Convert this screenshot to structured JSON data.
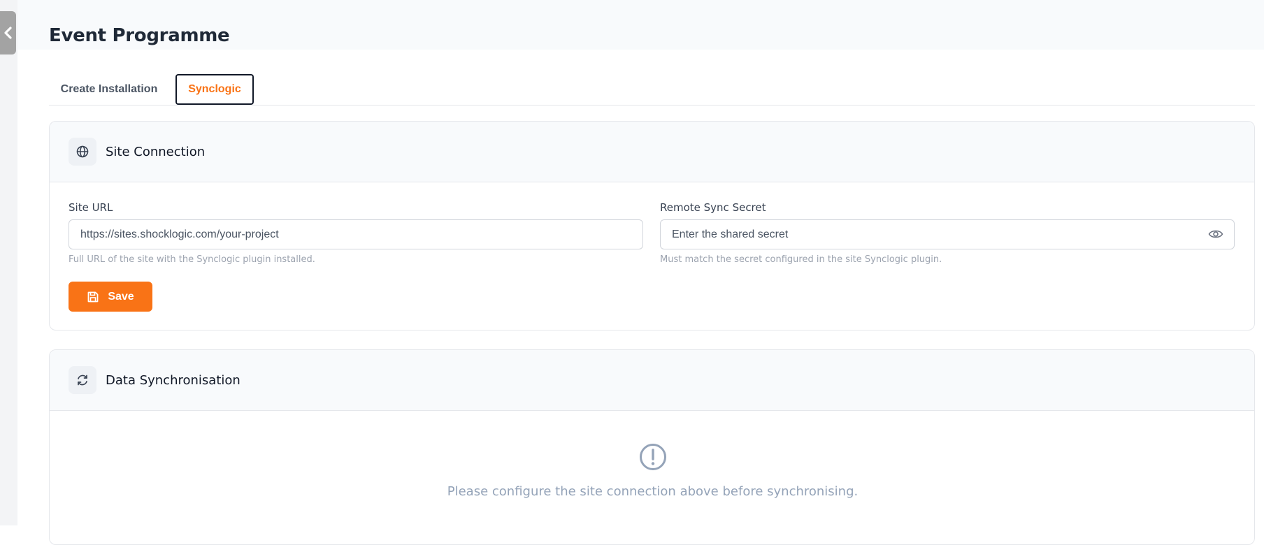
{
  "page": {
    "title": "Event Programme"
  },
  "tabs": [
    {
      "label": "Create Installation",
      "active": false
    },
    {
      "label": "Synclogic",
      "active": true
    }
  ],
  "site_connection": {
    "title": "Site Connection",
    "icon": "globe-icon",
    "site_url": {
      "label": "Site URL",
      "value": "",
      "placeholder": "https://sites.shocklogic.com/your-project",
      "hint": "Full URL of the site with the Synclogic plugin installed."
    },
    "remote_secret": {
      "label": "Remote Sync Secret",
      "value": "",
      "placeholder": "Enter the shared secret",
      "hint": "Must match the secret configured in the site Synclogic plugin."
    },
    "save_label": "Save"
  },
  "data_sync": {
    "title": "Data Synchronisation",
    "icon": "refresh-icon",
    "empty_icon": "exclamation-circle-icon",
    "empty_message": "Please configure the site connection above before synchronising."
  },
  "colors": {
    "accent": "#f97316",
    "muted": "#94a3b8",
    "border": "#e5e7eb"
  }
}
